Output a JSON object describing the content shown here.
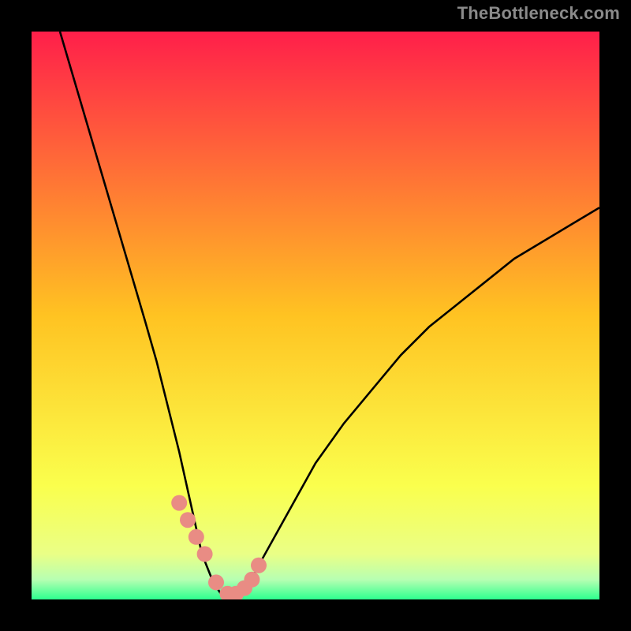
{
  "watermark": "TheBottleneck.com",
  "colors": {
    "background": "#000000",
    "gradient_top": "#ff1f4a",
    "gradient_mid": "#ffde2b",
    "gradient_bottom": "#2dff8f",
    "curve": "#000000",
    "marker": "#e98c84"
  },
  "chart_data": {
    "type": "line",
    "title": "",
    "xlabel": "",
    "ylabel": "",
    "xlim": [
      0,
      100
    ],
    "ylim": [
      0,
      100
    ],
    "x": [
      5,
      10,
      15,
      20,
      22,
      24,
      26,
      28,
      30,
      32,
      34,
      36,
      38,
      40,
      45,
      50,
      55,
      60,
      65,
      70,
      75,
      80,
      85,
      90,
      95,
      100
    ],
    "values": [
      100,
      83,
      66,
      49,
      42,
      34,
      26,
      17,
      8,
      3,
      0,
      0,
      2,
      6,
      15,
      24,
      31,
      37,
      43,
      48,
      52,
      56,
      60,
      63,
      66,
      69
    ],
    "markers": {
      "x": [
        26,
        27.5,
        29,
        30.5,
        32.5,
        34.5,
        36,
        37.5,
        38.8,
        40
      ],
      "y": [
        17,
        14,
        11,
        8,
        3,
        1,
        1,
        2,
        3.5,
        6
      ]
    },
    "gradient_stops": [
      {
        "offset": 0.0,
        "color": "#ff1f4a"
      },
      {
        "offset": 0.5,
        "color": "#ffc322"
      },
      {
        "offset": 0.8,
        "color": "#faff4d"
      },
      {
        "offset": 0.92,
        "color": "#eaff86"
      },
      {
        "offset": 0.965,
        "color": "#b7ffb2"
      },
      {
        "offset": 1.0,
        "color": "#2dff8f"
      }
    ]
  }
}
